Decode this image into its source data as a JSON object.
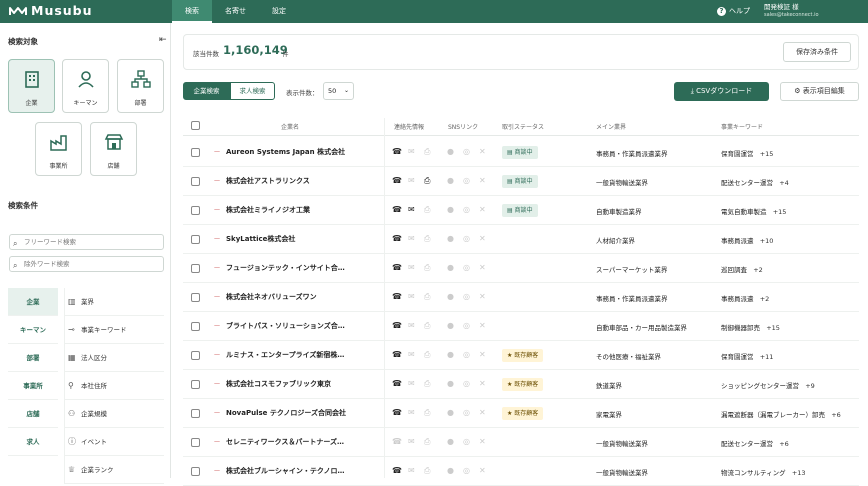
{
  "app": {
    "name": "Musubu"
  },
  "nav": {
    "tabs": [
      "検索",
      "名寄せ",
      "設定"
    ]
  },
  "header": {
    "help": "ヘルプ",
    "user_name": "開発検証 様",
    "user_email": "sales@takeconnect.io"
  },
  "sidebar": {
    "search_target_title": "検索対象",
    "targets": [
      "企業",
      "キーマン",
      "部署",
      "事業所",
      "店舗"
    ],
    "conditions_title": "検索条件",
    "freeword_placeholder": "フリーワード検索",
    "exclude_placeholder": "除外ワード検索",
    "tabs": [
      "企業",
      "キーマン",
      "部署",
      "事業所",
      "店舗",
      "求人"
    ],
    "conditions": [
      "業界",
      "事業キーワード",
      "法人区分",
      "本社住所",
      "企業規模",
      "イベント",
      "企業ランク"
    ]
  },
  "summary": {
    "count_label": "該当件数",
    "count": "1,160,149",
    "unit": "件",
    "saved_button": "保存済み条件"
  },
  "toolbar": {
    "seg_company": "企業検索",
    "seg_jobs": "求人検索",
    "display_label": "表示件数：",
    "display_value": "50",
    "csv_button": "CSVダウンロード",
    "columns_button": "表示項目編集"
  },
  "table": {
    "headers": [
      "企業名",
      "連絡先情報",
      "SNSリンク",
      "取引ステータス",
      "メイン業界",
      "事業キーワード"
    ],
    "rows": [
      {
        "name": "Aureon Systems Japan 株式会社",
        "status": "商談中",
        "industry": "事務員・作業員派遣業界",
        "keyword": "保育園運営",
        "more": "+15"
      },
      {
        "name": "株式会社アストラリンクス",
        "status": "商談中",
        "industry": "一般貨物輸送業界",
        "keyword": "配送センター運営",
        "more": "+4"
      },
      {
        "name": "株式会社ミライノジオ工業",
        "status": "商談中",
        "industry": "自動車製造業界",
        "keyword": "電気自動車製造",
        "more": "+15"
      },
      {
        "name": "SkyLattice株式会社",
        "status": "",
        "industry": "人材紹介業界",
        "keyword": "事務員派遣",
        "more": "+10"
      },
      {
        "name": "フュージョンテック・インサイト合…",
        "status": "",
        "industry": "スーパーマーケット業界",
        "keyword": "巡回調査",
        "more": "+2"
      },
      {
        "name": "株式会社ネオバリューズワン",
        "status": "",
        "industry": "事務員・作業員派遣業界",
        "keyword": "事務員派遣",
        "more": "+2"
      },
      {
        "name": "ブライトパス・ソリューションズ合…",
        "status": "",
        "industry": "自動車部品・カー用品製造業界",
        "keyword": "制御機器卸売",
        "more": "+15"
      },
      {
        "name": "ルミナス・エンタープライズ新宿株…",
        "status": "既存顧客",
        "industry": "その他医療・福祉業界",
        "keyword": "保育園運営",
        "more": "+11"
      },
      {
        "name": "株式会社コスモファブリック東京",
        "status": "既存顧客",
        "industry": "鉄道業界",
        "keyword": "ショッピングセンター運営",
        "more": "+9"
      },
      {
        "name": "NovaPulse テクノロジーズ合同会社",
        "status": "既存顧客",
        "industry": "家電業界",
        "keyword": "漏電遮断器（漏電ブレーカー）卸売",
        "more": "+6"
      },
      {
        "name": "セレニティワークス＆パートナーズ…",
        "status": "",
        "industry": "一般貨物輸送業界",
        "keyword": "配送センター運営",
        "more": "+6"
      },
      {
        "name": "株式会社ブルーシャイン・テクノロ…",
        "status": "",
        "industry": "一般貨物輸送業界",
        "keyword": "物流コンサルティング",
        "more": "+13"
      }
    ]
  },
  "colors": {
    "brand": "#2d6b57"
  }
}
